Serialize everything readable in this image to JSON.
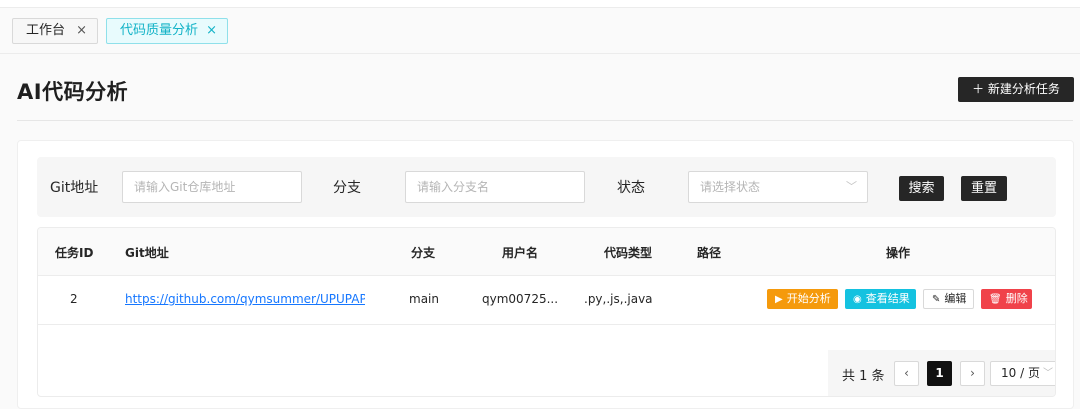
{
  "tabs": [
    {
      "label": "工作台",
      "close": "×"
    },
    {
      "label": "代码质量分析",
      "close": "×"
    }
  ],
  "page": {
    "title": "AI代码分析",
    "new_task_label": "＋ 新建分析任务"
  },
  "filter": {
    "git_label": "Git地址",
    "git_placeholder": "请输入Git仓库地址",
    "branch_label": "分支",
    "branch_placeholder": "请输入分支名",
    "status_label": "状态",
    "status_placeholder": "请选择状态",
    "search_label": "搜索",
    "reset_label": "重置"
  },
  "table": {
    "headers": {
      "id": "任务ID",
      "git": "Git地址",
      "branch": "分支",
      "user": "用户名",
      "type": "代码类型",
      "path": "路径",
      "ops": "操作"
    },
    "rows": [
      {
        "id": "2",
        "git": "https://github.com/qymsummer/UPUPAPI",
        "branch": "main",
        "user": "qym00725...",
        "type": ".py,.js,.java",
        "path": ""
      }
    ],
    "actions": {
      "start": "开始分析",
      "view": "查看结果",
      "edit": "编辑",
      "delete": "删除"
    }
  },
  "pagination": {
    "total": "共 1 条",
    "prev": "‹",
    "current": "1",
    "next": "›",
    "page_size": "10 / 页"
  },
  "colors": {
    "start": "#f59a0c",
    "view": "#14c2e0",
    "delete": "#f0424a",
    "link": "#1677ff",
    "active_tab": "#13b3c7"
  }
}
